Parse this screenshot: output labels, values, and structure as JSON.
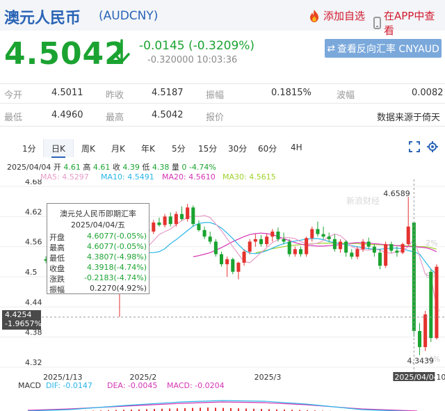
{
  "header": {
    "title": "澳元人民币",
    "code": "(AUDCNY)",
    "add_fav": "添加自选",
    "open_app": "在APP中查看"
  },
  "quote": {
    "price": "4.5042",
    "change": "-0.0145 (-0.3209%)",
    "sub": "-0.320000  10:03:36",
    "reverse_btn": "查看反向汇率 CNYAUD"
  },
  "stats": {
    "open_label": "今开",
    "open": "4.5011",
    "prev_label": "昨收",
    "prev": "4.5187",
    "amp_label": "振幅",
    "amp": "0.1815%",
    "wave_label": "波幅",
    "wave": "0.0082",
    "low_label": "最低",
    "low": "4.4960",
    "high_label": "最高",
    "high": "4.5042",
    "quote_label": "报价",
    "source": "数据来源于倚天"
  },
  "tabs": [
    "1分",
    "日K",
    "周K",
    "月K",
    "年K",
    "5分",
    "15分",
    "30分",
    "60分",
    "4H"
  ],
  "active_tab": "日K",
  "ohlc": {
    "date": "2025/04/04",
    "open_label": "开",
    "open": "4.61",
    "high_label": "高",
    "high": "4.61",
    "close_label": "收",
    "close": "4.39",
    "low_label": "低",
    "low": "4.38",
    "vol_label": "量",
    "vol": "0",
    "pct": "-4.74%"
  },
  "ma": {
    "ma5": "MA5: 4.5297",
    "ma10": "MA10: 4.5491",
    "ma20": "MA20: 4.5610",
    "ma30": "MA30: 4.5615"
  },
  "colors": {
    "ma5": "#e79cc9",
    "ma10": "#29b6e8",
    "ma20": "#d534b4",
    "ma30": "#9fd22b",
    "up": "#e4322e",
    "down": "#1ba331"
  },
  "tooltip": {
    "title": "澳元兑人民币即期汇率",
    "date": "2025/04/04/五",
    "rows": [
      {
        "label": "开盘",
        "value": "4.6077(-0.05%)",
        "green": true
      },
      {
        "label": "最高",
        "value": "4.6077(-0.05%)",
        "green": true
      },
      {
        "label": "最低",
        "value": "4.3807(-4.98%)",
        "green": true
      },
      {
        "label": "收盘",
        "value": "4.3918(-4.74%)",
        "green": true
      },
      {
        "label": "涨跌",
        "value": "-0.2183(-4.74%)",
        "green": true
      },
      {
        "label": "振幅",
        "value": "0.2270(4.92%)",
        "green": false
      }
    ]
  },
  "crosshair": {
    "price": "4.4254",
    "pct": "-1.9657%"
  },
  "macd": {
    "label": "MACD",
    "dif": "DIF: -0.0147",
    "dea": "DEA: -0.0045",
    "macd": "MACD: -0.0204"
  },
  "chart_data": {
    "type": "candlestick",
    "y_ticks": [
      "4.68",
      "4.62",
      "4.56",
      "4.5",
      "4.44",
      "4.38",
      "4.32"
    ],
    "ylim": [
      4.32,
      4.68
    ],
    "x_ticks": [
      "2025/1/13",
      "2025/2",
      "2025/3"
    ],
    "x_crosshair_label": "2025/04/04",
    "x_tail_label": "10",
    "right_pct_ticks": [
      "2%",
      "0%",
      "-2%",
      "-4%"
    ],
    "max_label": "4.6589",
    "min_label": "4.3439",
    "watermark": "新浪财经",
    "candles": [
      [
        4.535,
        4.541,
        4.527,
        4.532
      ],
      [
        4.532,
        4.538,
        4.52,
        4.528
      ],
      [
        4.528,
        4.54,
        4.525,
        4.538
      ],
      [
        4.538,
        4.548,
        4.53,
        4.545
      ],
      [
        4.545,
        4.553,
        4.537,
        4.54
      ],
      [
        4.54,
        4.55,
        4.53,
        4.548
      ],
      [
        4.548,
        4.556,
        4.54,
        4.552
      ],
      [
        4.552,
        4.558,
        4.542,
        4.545
      ],
      [
        4.545,
        4.549,
        4.533,
        4.537
      ],
      [
        4.537,
        4.545,
        4.528,
        4.54
      ],
      [
        4.54,
        4.56,
        4.538,
        4.558
      ],
      [
        4.558,
        4.562,
        4.545,
        4.55
      ],
      [
        4.55,
        4.553,
        4.52,
        4.527
      ],
      [
        4.527,
        4.532,
        4.42,
        4.56
      ],
      [
        4.56,
        4.58,
        4.552,
        4.575
      ],
      [
        4.575,
        4.593,
        4.57,
        4.59
      ],
      [
        4.59,
        4.596,
        4.568,
        4.572
      ],
      [
        4.572,
        4.598,
        4.568,
        4.595
      ],
      [
        4.595,
        4.61,
        4.585,
        4.59
      ],
      [
        4.59,
        4.613,
        4.585,
        4.608
      ],
      [
        4.608,
        4.618,
        4.6,
        4.603
      ],
      [
        4.603,
        4.625,
        4.598,
        4.62
      ],
      [
        4.62,
        4.628,
        4.6,
        4.605
      ],
      [
        4.605,
        4.63,
        4.6,
        4.625
      ],
      [
        4.625,
        4.64,
        4.612,
        4.615
      ],
      [
        4.615,
        4.645,
        4.61,
        4.638
      ],
      [
        4.638,
        4.642,
        4.6,
        4.605
      ],
      [
        4.605,
        4.612,
        4.59,
        4.593
      ],
      [
        4.593,
        4.6,
        4.575,
        4.58
      ],
      [
        4.58,
        4.59,
        4.565,
        4.57
      ],
      [
        4.57,
        4.575,
        4.54,
        4.545
      ],
      [
        4.545,
        4.55,
        4.52,
        4.525
      ],
      [
        4.525,
        4.54,
        4.5,
        4.535
      ],
      [
        4.535,
        4.538,
        4.505,
        4.51
      ],
      [
        4.51,
        4.53,
        4.495,
        4.528
      ],
      [
        4.528,
        4.555,
        4.522,
        4.55
      ],
      [
        4.55,
        4.575,
        4.545,
        4.57
      ],
      [
        4.57,
        4.585,
        4.56,
        4.575
      ],
      [
        4.575,
        4.583,
        4.56,
        4.565
      ],
      [
        4.565,
        4.585,
        4.56,
        4.58
      ],
      [
        4.58,
        4.595,
        4.57,
        4.59
      ],
      [
        4.59,
        4.598,
        4.57,
        4.575
      ],
      [
        4.575,
        4.588,
        4.565,
        4.57
      ],
      [
        4.57,
        4.575,
        4.54,
        4.545
      ],
      [
        4.545,
        4.56,
        4.54,
        4.555
      ],
      [
        4.555,
        4.56,
        4.54,
        4.545
      ],
      [
        4.545,
        4.58,
        4.54,
        4.577
      ],
      [
        4.577,
        4.6,
        4.57,
        4.595
      ],
      [
        4.595,
        4.61,
        4.58,
        4.585
      ],
      [
        4.585,
        4.6,
        4.575,
        4.58
      ],
      [
        4.58,
        4.588,
        4.57,
        4.575
      ],
      [
        4.575,
        4.585,
        4.55,
        4.555
      ],
      [
        4.555,
        4.575,
        4.548,
        4.57
      ],
      [
        4.57,
        4.573,
        4.54,
        4.548
      ],
      [
        4.548,
        4.555,
        4.535,
        4.54
      ],
      [
        4.54,
        4.56,
        4.535,
        4.555
      ],
      [
        4.555,
        4.575,
        4.55,
        4.57
      ],
      [
        4.57,
        4.578,
        4.555,
        4.56
      ],
      [
        4.56,
        4.565,
        4.54,
        4.548
      ],
      [
        4.548,
        4.555,
        4.515,
        4.522
      ],
      [
        4.522,
        4.57,
        4.518,
        4.565
      ],
      [
        4.565,
        4.57,
        4.548,
        4.552
      ],
      [
        4.552,
        4.56,
        4.54,
        4.548
      ],
      [
        4.548,
        4.568,
        4.545,
        4.565
      ],
      [
        4.565,
        4.659,
        4.56,
        4.6
      ],
      [
        4.608,
        4.608,
        4.381,
        4.392
      ],
      [
        4.392,
        4.408,
        4.344,
        4.36
      ],
      [
        4.36,
        4.432,
        4.352,
        4.425
      ],
      [
        4.51,
        4.515,
        4.37,
        4.378
      ],
      [
        4.378,
        4.525,
        4.375,
        4.52
      ]
    ],
    "ma5": [
      4.535,
      4.538,
      4.54,
      4.544,
      4.547,
      4.55,
      4.549,
      4.545,
      4.544,
      4.548,
      4.552,
      4.545,
      4.56,
      4.572,
      4.584,
      4.59,
      4.595,
      4.604,
      4.612,
      4.618,
      4.621,
      4.62,
      4.622,
      4.618,
      4.605,
      4.592,
      4.576,
      4.56,
      4.545,
      4.53,
      4.528,
      4.538,
      4.548,
      4.558,
      4.568,
      4.574,
      4.578,
      4.578,
      4.576,
      4.57,
      4.566,
      4.565,
      4.567,
      4.572,
      4.58,
      4.585,
      4.582,
      4.572,
      4.56,
      4.556,
      4.554,
      4.553,
      4.555,
      4.553,
      4.548,
      4.547,
      4.55,
      4.552,
      4.56,
      4.575,
      4.54,
      4.505,
      4.5,
      4.44
    ],
    "ma10": [
      4.536,
      4.538,
      4.54,
      4.542,
      4.544,
      4.546,
      4.548,
      4.548,
      4.55,
      4.556,
      4.566,
      4.574,
      4.583,
      4.592,
      4.601,
      4.606,
      4.608,
      4.608,
      4.604,
      4.597,
      4.587,
      4.576,
      4.564,
      4.553,
      4.547,
      4.546,
      4.548,
      4.552,
      4.557,
      4.562,
      4.566,
      4.569,
      4.571,
      4.573,
      4.575,
      4.576,
      4.576,
      4.574,
      4.57,
      4.568,
      4.566,
      4.564,
      4.562,
      4.56,
      4.558,
      4.556,
      4.555,
      4.555,
      4.556,
      4.557,
      4.557,
      4.556,
      4.552,
      4.55,
      4.545,
      4.53,
      4.515,
      4.505
    ],
    "ma20": [
      4.54,
      4.542,
      4.545,
      4.548,
      4.553,
      4.558,
      4.564,
      4.57,
      4.575,
      4.58,
      4.584,
      4.586,
      4.587,
      4.586,
      4.584,
      4.58,
      4.576,
      4.572,
      4.568,
      4.565,
      4.563,
      4.562,
      4.561,
      4.561,
      4.562,
      4.563,
      4.564,
      4.566,
      4.567,
      4.568,
      4.568,
      4.567,
      4.566,
      4.565,
      4.564,
      4.563,
      4.562,
      4.561,
      4.56,
      4.56,
      4.559,
      4.558,
      4.555,
      4.55
    ],
    "ma30": [
      4.548,
      4.55,
      4.553,
      4.556,
      4.558,
      4.56,
      4.562,
      4.563,
      4.564,
      4.565,
      4.566,
      4.566,
      4.567,
      4.567,
      4.567,
      4.567,
      4.567,
      4.566,
      4.566,
      4.565,
      4.565,
      4.564,
      4.564,
      4.563,
      4.563,
      4.562,
      4.562,
      4.561,
      4.561,
      4.56,
      4.56,
      4.558,
      4.555
    ]
  }
}
